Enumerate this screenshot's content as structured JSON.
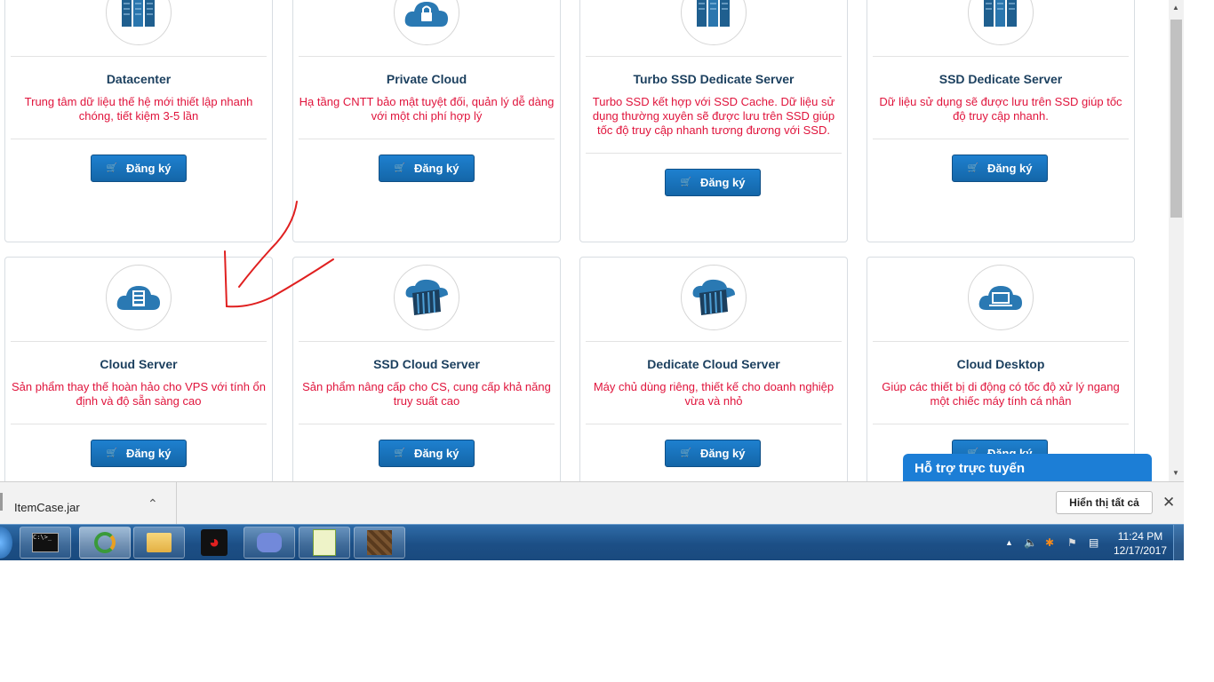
{
  "cards_row1": [
    {
      "title": "Datacenter",
      "description": "Trung tâm dữ liệu thế hệ mới thiết lập nhanh chóng, tiết kiệm 3-5 lần",
      "button": "Đăng ký"
    },
    {
      "title": "Private Cloud",
      "description": "Hạ tầng CNTT bảo mật tuyệt đối, quản lý dễ dàng với một chi phí hợp lý",
      "button": "Đăng ký"
    },
    {
      "title": "Turbo SSD Dedicate Server",
      "description": "Turbo SSD kết hợp với SSD Cache. Dữ liệu sử dụng thường xuyên sẽ được lưu trên SSD giúp tốc độ truy cập nhanh tương đương với SSD.",
      "button": "Đăng ký"
    },
    {
      "title": "SSD Dedicate Server",
      "description": "Dữ liệu sử dụng sẽ được lưu trên SSD giúp tốc độ truy cập nhanh.",
      "button": "Đăng ký"
    }
  ],
  "cards_row2": [
    {
      "title": "Cloud Server",
      "description": "Sản phẩm thay thế hoàn hảo cho VPS với tính ổn định và độ sẵn sàng cao",
      "button": "Đăng ký"
    },
    {
      "title": "SSD Cloud Server",
      "description": "Sản phẩm nâng cấp cho CS, cung cấp khả năng truy suất cao",
      "button": "Đăng ký"
    },
    {
      "title": "Dedicate Cloud Server",
      "description": "Máy chủ dùng riêng, thiết kế cho doanh nghiệp vừa và nhỏ",
      "button": "Đăng ký"
    },
    {
      "title": "Cloud Desktop",
      "description": "Giúp các thiết bị di động có tốc độ xử lý ngang một chiếc máy tính cá nhân",
      "button": "Đăng ký"
    }
  ],
  "chat_widget": {
    "label": "Hỗ trợ trực tuyến"
  },
  "download_bar": {
    "file_name": "ItemCase.jar",
    "show_all_label": "Hiển thị tất cả"
  },
  "taskbar": {
    "time": "11:24 PM",
    "date": "12/17/2017"
  },
  "colors": {
    "title": "#1b3f5e",
    "description": "#e0143c",
    "button": "#1466a8",
    "annotation": "#e02020"
  }
}
